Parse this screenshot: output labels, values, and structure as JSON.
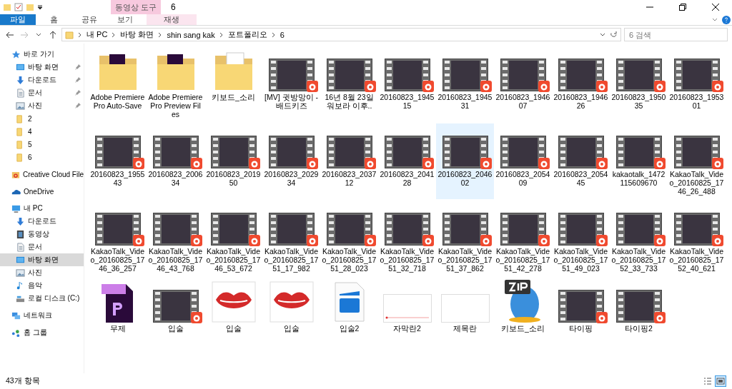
{
  "window": {
    "title": "6",
    "context_tab": "동영상 도구"
  },
  "ribbon_tabs": [
    {
      "label": "파일",
      "kind": "file"
    },
    {
      "label": "홈",
      "kind": "normal"
    },
    {
      "label": "공유",
      "kind": "normal"
    },
    {
      "label": "보기",
      "kind": "normal"
    },
    {
      "label": "재생",
      "kind": "context"
    }
  ],
  "address": {
    "crumbs": [
      "내 PC",
      "바탕 화면",
      "shin sang kak",
      "포트폴리오",
      "6"
    ]
  },
  "search": {
    "placeholder": "6 검색"
  },
  "sidebar": {
    "items": [
      {
        "label": "바로 가기",
        "kind": "star",
        "selected": false,
        "children": [
          {
            "label": "바탕 화면",
            "kind": "desktop",
            "selected": false,
            "pinned": true
          },
          {
            "label": "다운로드",
            "kind": "download",
            "selected": false,
            "pinned": true
          },
          {
            "label": "문서",
            "kind": "document",
            "selected": false,
            "pinned": true
          },
          {
            "label": "사진",
            "kind": "pictures",
            "selected": false,
            "pinned": true
          },
          {
            "label": "2",
            "kind": "folder",
            "selected": false,
            "pinned": false
          },
          {
            "label": "4",
            "kind": "folder",
            "selected": false,
            "pinned": false
          },
          {
            "label": "5",
            "kind": "folder",
            "selected": false,
            "pinned": false
          },
          {
            "label": "6",
            "kind": "folder",
            "selected": false,
            "pinned": false
          }
        ]
      },
      {
        "label": "Creative Cloud File",
        "kind": "cc",
        "selected": false
      },
      {
        "label": "OneDrive",
        "kind": "cloud",
        "selected": false
      },
      {
        "label": "내 PC",
        "kind": "pc",
        "selected": false,
        "children": [
          {
            "label": "다운로드",
            "kind": "download",
            "selected": false
          },
          {
            "label": "동영상",
            "kind": "video",
            "selected": false
          },
          {
            "label": "문서",
            "kind": "document",
            "selected": false
          },
          {
            "label": "바탕 화면",
            "kind": "desktop",
            "selected": true
          },
          {
            "label": "사진",
            "kind": "pictures",
            "selected": false
          },
          {
            "label": "음악",
            "kind": "music",
            "selected": false
          },
          {
            "label": "로컬 디스크 (C:)",
            "kind": "disk",
            "selected": false
          }
        ]
      },
      {
        "label": "네트워크",
        "kind": "network",
        "selected": false
      },
      {
        "label": "홈 그룹",
        "kind": "homegroup",
        "selected": false
      }
    ]
  },
  "files": [
    {
      "name": "Adobe Premiere Pro Auto-Save",
      "kind": "premiere-folder",
      "selected": false
    },
    {
      "name": "Adobe Premiere Pro Preview Files",
      "kind": "premiere-folder",
      "selected": false
    },
    {
      "name": "키보드_소리",
      "kind": "doc-folder",
      "selected": false
    },
    {
      "name": "[MV] 귓방망이 - 배드키즈",
      "kind": "video",
      "selected": false
    },
    {
      "name": "16년 8월 23일 워보라 이후..",
      "kind": "video",
      "selected": false
    },
    {
      "name": "20160823_194515",
      "kind": "video",
      "selected": false
    },
    {
      "name": "20160823_194531",
      "kind": "video",
      "selected": false
    },
    {
      "name": "20160823_194607",
      "kind": "video",
      "selected": false
    },
    {
      "name": "20160823_194626",
      "kind": "video",
      "selected": false
    },
    {
      "name": "20160823_195035",
      "kind": "video",
      "selected": false
    },
    {
      "name": "20160823_195301",
      "kind": "video",
      "selected": false
    },
    {
      "name": "20160823_195543",
      "kind": "video",
      "selected": false
    },
    {
      "name": "20160823_200634",
      "kind": "video",
      "selected": false
    },
    {
      "name": "20160823_201950",
      "kind": "video",
      "selected": false
    },
    {
      "name": "20160823_202934",
      "kind": "video",
      "selected": false
    },
    {
      "name": "20160823_203712",
      "kind": "video",
      "selected": false
    },
    {
      "name": "20160823_204128",
      "kind": "video",
      "selected": false
    },
    {
      "name": "20160823_204602",
      "kind": "video",
      "selected": true
    },
    {
      "name": "20160823_205409",
      "kind": "video",
      "selected": false
    },
    {
      "name": "20160823_205445",
      "kind": "video",
      "selected": false
    },
    {
      "name": "kakaotalk_1472115609670",
      "kind": "video",
      "selected": false
    },
    {
      "name": "KakaoTalk_Video_20160825_1746_26_488",
      "kind": "video",
      "selected": false
    },
    {
      "name": "KakaoTalk_Video_20160825_1746_36_257",
      "kind": "video",
      "selected": false
    },
    {
      "name": "KakaoTalk_Video_20160825_1746_43_768",
      "kind": "video",
      "selected": false
    },
    {
      "name": "KakaoTalk_Video_20160825_1746_53_672",
      "kind": "video",
      "selected": false
    },
    {
      "name": "KakaoTalk_Video_20160825_1751_17_982",
      "kind": "video",
      "selected": false
    },
    {
      "name": "KakaoTalk_Video_20160825_1751_28_023",
      "kind": "video",
      "selected": false
    },
    {
      "name": "KakaoTalk_Video_20160825_1751_32_718",
      "kind": "video",
      "selected": false
    },
    {
      "name": "KakaoTalk_Video_20160825_1751_37_862",
      "kind": "video",
      "selected": false
    },
    {
      "name": "KakaoTalk_Video_20160825_1751_42_278",
      "kind": "video",
      "selected": false
    },
    {
      "name": "KakaoTalk_Video_20160825_1751_49_023",
      "kind": "video",
      "selected": false
    },
    {
      "name": "KakaoTalk_Video_20160825_1752_33_733",
      "kind": "video",
      "selected": false
    },
    {
      "name": "KakaoTalk_Video_20160825_1752_40_621",
      "kind": "video",
      "selected": false
    },
    {
      "name": "무제",
      "kind": "premiere-project",
      "selected": false
    },
    {
      "name": "입술",
      "kind": "video",
      "selected": false
    },
    {
      "name": "입술",
      "kind": "lips-image",
      "selected": false
    },
    {
      "name": "입술",
      "kind": "lips-image",
      "selected": false
    },
    {
      "name": "입술2",
      "kind": "clapper-file",
      "selected": false
    },
    {
      "name": "자막란2",
      "kind": "subtitle-image",
      "selected": false
    },
    {
      "name": "제목란",
      "kind": "blank-image",
      "selected": false
    },
    {
      "name": "키보드_소리",
      "kind": "zip-app",
      "selected": false
    },
    {
      "name": "타이핑",
      "kind": "video",
      "selected": false
    },
    {
      "name": "타이핑2",
      "kind": "video",
      "selected": false
    }
  ],
  "status_bar": {
    "count": "43개 항목",
    "views": [
      {
        "kind": "details",
        "selected": false
      },
      {
        "kind": "large-icons",
        "selected": true
      }
    ]
  }
}
